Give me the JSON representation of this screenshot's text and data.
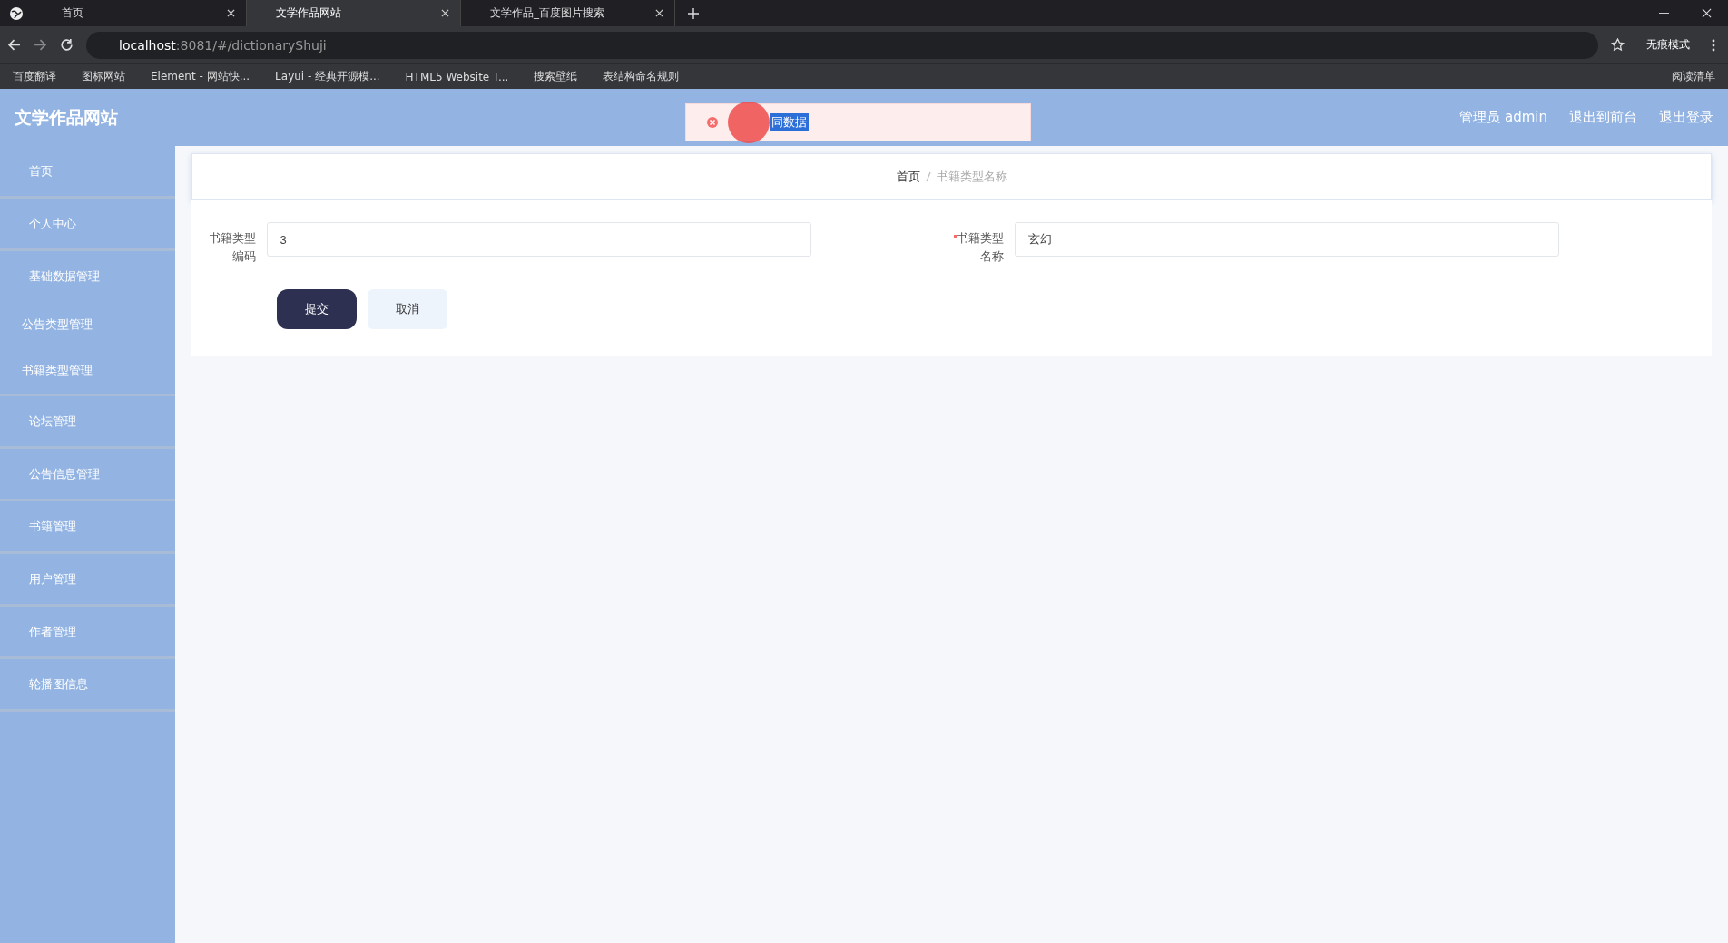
{
  "browser": {
    "tabs": [
      {
        "title": "首页",
        "selected": false
      },
      {
        "title": "文学作品网站",
        "selected": true
      },
      {
        "title": "文学作品_百度图片搜索",
        "selected": false
      }
    ],
    "url": {
      "host": "localhost",
      "rest": ":8081/#/dictionaryShuji"
    },
    "profile": "无痕模式",
    "bookmarks": [
      "百度翻译",
      "图标网站",
      "Element - 网站快...",
      "Layui - 经典开源模...",
      "HTML5 Website T...",
      "搜索壁纸",
      "表结构命名规则"
    ],
    "reading_list": "阅读清单"
  },
  "header": {
    "title": "文学作品网站",
    "links": [
      "管理员 admin",
      "退出到前台",
      "退出登录"
    ]
  },
  "toast": {
    "message": "同数据"
  },
  "sidebar": {
    "items": [
      {
        "label": "首页"
      },
      {
        "label": "个人中心"
      },
      {
        "label": "基础数据管理",
        "children": [
          "公告类型管理",
          "书籍类型管理"
        ]
      },
      {
        "label": "论坛管理"
      },
      {
        "label": "公告信息管理"
      },
      {
        "label": "书籍管理"
      },
      {
        "label": "用户管理"
      },
      {
        "label": "作者管理"
      },
      {
        "label": "轮播图信息"
      }
    ]
  },
  "breadcrumb": [
    "首页",
    "书籍类型名称"
  ],
  "form": {
    "fields": [
      {
        "label": "书籍类型编码",
        "required": false,
        "value": "3"
      },
      {
        "label": "书籍类型名称",
        "required": true,
        "value": "玄幻"
      }
    ],
    "buttons": [
      "提交",
      "取消"
    ]
  }
}
